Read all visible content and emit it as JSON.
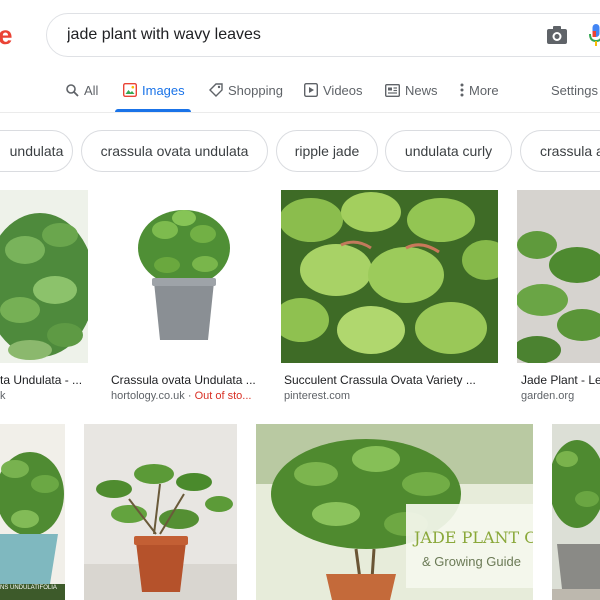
{
  "logo_fragment": "e",
  "search": {
    "query": "jade plant with wavy leaves"
  },
  "icons": {
    "camera": "camera-icon",
    "mic": "microphone-icon"
  },
  "tabs": [
    {
      "label": "All",
      "icon": "search-icon"
    },
    {
      "label": "Images",
      "icon": "images-icon",
      "active": true
    },
    {
      "label": "Shopping",
      "icon": "tag-icon"
    },
    {
      "label": "Videos",
      "icon": "play-icon"
    },
    {
      "label": "News",
      "icon": "newspaper-icon"
    },
    {
      "label": "More",
      "icon": "more-vert-icon"
    },
    {
      "label": "Settings"
    }
  ],
  "chips": [
    "undulata",
    "crassula ovata undulata",
    "ripple jade",
    "undulata curly",
    "crassula a"
  ],
  "results": [
    {
      "caption": "ta Undulata - ...",
      "source": "k"
    },
    {
      "caption": "Crassula ovata Undulata ...",
      "source": "hortology.co.uk",
      "status": "Out of sto..."
    },
    {
      "caption": "Succulent Crassula Ovata Variety ...",
      "source": "pinterest.com"
    },
    {
      "caption": "Jade Plant - Le",
      "source": "garden.org"
    },
    {
      "image_text": "NS UNDULATIFOLIA"
    },
    {},
    {
      "image_text_line1": "JADE PLANT CARE",
      "image_text_line2": "& Growing Guide"
    },
    {}
  ],
  "colors": {
    "accent": "#1a73e8",
    "logo_red": "#ea4335",
    "out_of_stock": "#d93025"
  }
}
